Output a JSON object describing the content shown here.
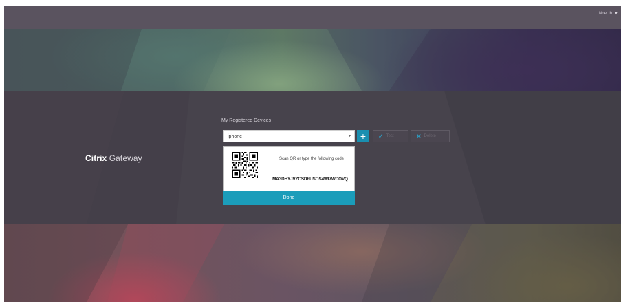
{
  "header": {
    "user_name": "Noel Ih",
    "caret_icon": "caret-down-icon"
  },
  "brand": {
    "bold": "Citrix",
    "light": " Gateway"
  },
  "devices": {
    "title": "My Registered Devices",
    "selected_device": "iphone",
    "add_label": "+",
    "test_label": "Test",
    "delete_label": "Delete"
  },
  "qr": {
    "instruction": "Scan QR or type the following code",
    "code": "MA3DHYJVZCSDFUSOS4WI7WDOVQ",
    "done_label": "Done"
  },
  "colors": {
    "accent": "#1b9dba",
    "panel": "#47434c",
    "topbar": "#5a535f"
  }
}
